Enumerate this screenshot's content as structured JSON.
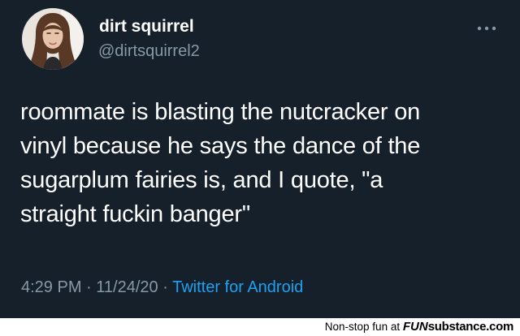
{
  "tweet": {
    "display_name": "dirt squirrel",
    "handle": "@dirtsquirrel2",
    "text_lines": [
      "roommate is blasting the nutcracker on",
      "vinyl because he says the dance of the",
      "sugarplum fairies is, and I quote, \"a",
      "straight fuckin banger\""
    ],
    "time": "4:29 PM",
    "separator": "·",
    "date": "11/24/20",
    "source": "Twitter for Android",
    "more_icon": "more-dots-icon"
  },
  "footer": {
    "tagline": "Non-stop fun at",
    "brand_fun": "FUN",
    "brand_rest": "substance.com"
  },
  "colors": {
    "background": "#15202b",
    "primary_text": "#ffffff",
    "secondary_text": "#8899a6",
    "link": "#1da1f2",
    "footer_bg": "#ffffff"
  }
}
